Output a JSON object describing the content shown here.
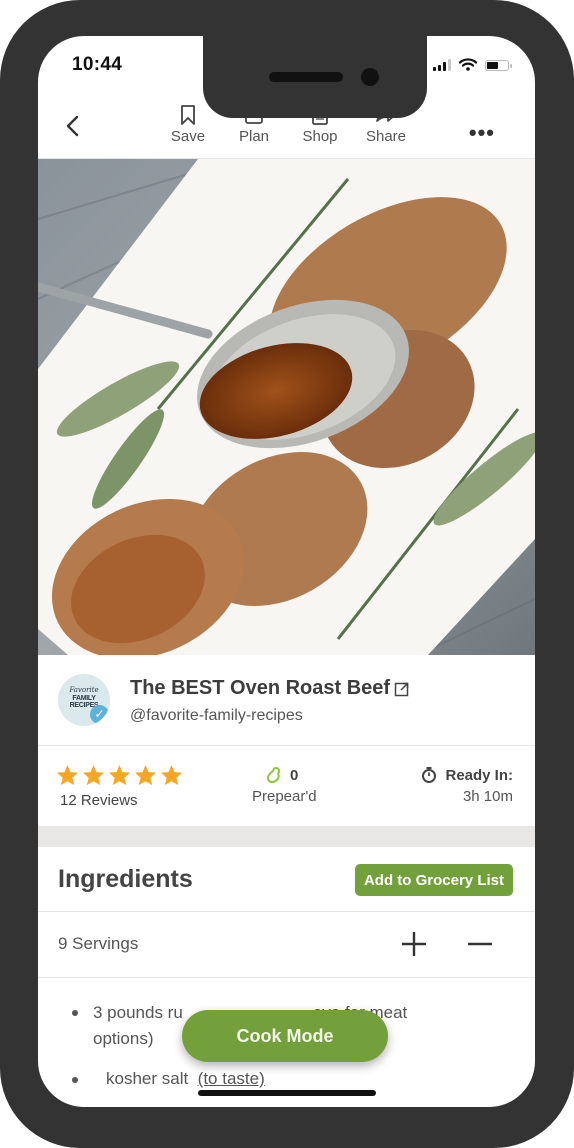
{
  "status_bar": {
    "time": "10:44",
    "signal_bars": 3,
    "signal_bars_total": 4,
    "battery_level": 0.6
  },
  "toolbar": {
    "back_icon": "chevron-left-icon",
    "actions": [
      {
        "label": "Save",
        "icon": "bookmark-icon"
      },
      {
        "label": "Plan",
        "icon": "calendar-icon"
      },
      {
        "label": "Shop",
        "icon": "clipboard-icon"
      },
      {
        "label": "Share",
        "icon": "share-arrow-icon"
      }
    ],
    "more": "•••"
  },
  "hero": {
    "alt": "Sliced oven roast beef with gravy on a spoon, rosemary and sage on a white platter"
  },
  "recipe": {
    "title": "The BEST Oven Roast Beef",
    "author_handle": "@favorite-family-recipes",
    "avatar_line1": "Favorite",
    "avatar_line2": "FAMILY RECIPES",
    "verified": true
  },
  "stats": {
    "rating": 5,
    "rating_max": 5,
    "reviews": "12 Reviews",
    "prepeard_count": "0",
    "prepeard_label": "Prepear'd",
    "ready_label": "Ready In:",
    "ready_value": "3h 10m"
  },
  "ingredients": {
    "title": "Ingredients",
    "grocery_button": "Add to Grocery List",
    "servings": "9 Servings",
    "items": [
      {
        "line1_start": "3  pounds  ru",
        "line1_end": "ove for meat",
        "line2": "options)"
      },
      {
        "name": "kosher salt",
        "note": "(to taste)"
      }
    ]
  },
  "cook_mode": {
    "label": "Cook Mode"
  },
  "colors": {
    "brand_green": "#72a13c",
    "star": "#f5a623",
    "frame": "#333333"
  }
}
